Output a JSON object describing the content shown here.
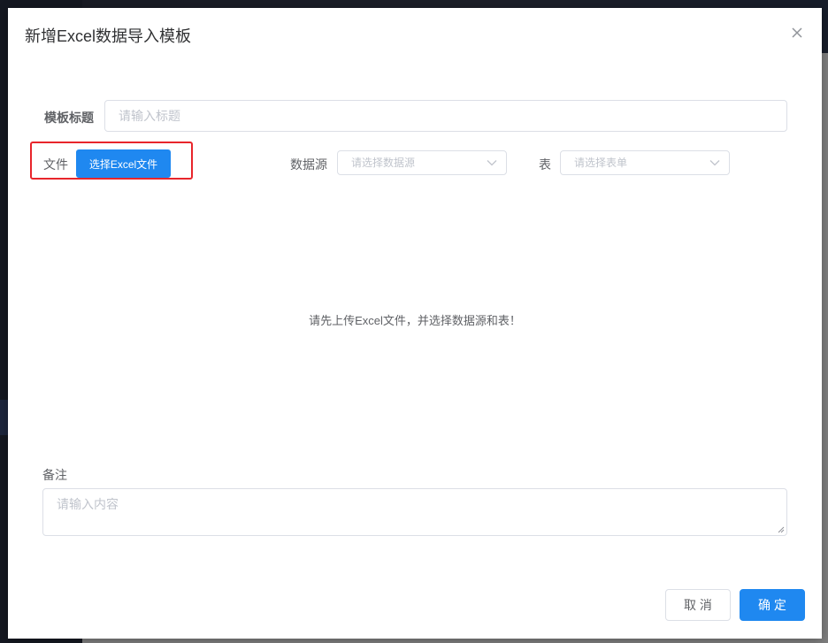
{
  "dialog": {
    "title": "新增Excel数据导入模板",
    "close_icon": "close-icon"
  },
  "form": {
    "template_title": {
      "label": "模板标题",
      "placeholder": "请输入标题",
      "value": ""
    },
    "file": {
      "label": "文件",
      "button_label": "选择Excel文件"
    },
    "datasource": {
      "label": "数据源",
      "placeholder": "请选择数据源"
    },
    "table": {
      "label": "表",
      "placeholder": "请选择表单"
    },
    "empty_tip": "请先上传Excel文件，并选择数据源和表！",
    "remark": {
      "label": "备注",
      "placeholder": "请输入内容",
      "value": ""
    }
  },
  "footer": {
    "cancel_label": "取 消",
    "confirm_label": "确 定"
  },
  "colors": {
    "primary": "#1f88f0",
    "highlight": "#e8252b"
  }
}
